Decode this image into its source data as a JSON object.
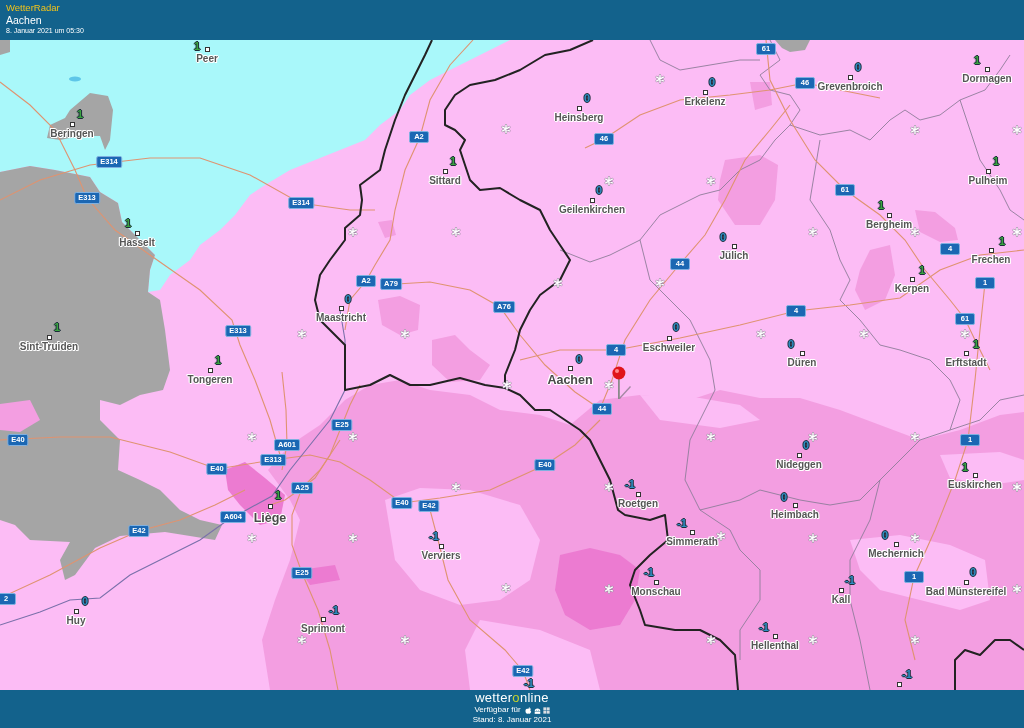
{
  "header": {
    "app_name": "WetterRadar",
    "location": "Aachen",
    "timestamp": "8. Januar 2021 um 05:30"
  },
  "map": {
    "places": [
      {
        "name": "Peer",
        "kind": "town",
        "temperature": "1",
        "color": "#3aa340"
      },
      {
        "name": "Grevenbroich",
        "kind": "town",
        "temperature": "0",
        "color": "#2f8dc2"
      },
      {
        "name": "Dormagen",
        "kind": "town",
        "temperature": "1",
        "color": "#3aa340"
      },
      {
        "name": "Erkelenz",
        "kind": "town",
        "temperature": "0",
        "color": "#2f8dc2"
      },
      {
        "name": "Heinsberg",
        "kind": "town",
        "temperature": "0",
        "color": "#2f8dc2"
      },
      {
        "name": "Beringen",
        "kind": "town",
        "temperature": "1",
        "color": "#3aa340"
      },
      {
        "name": "Sittard",
        "kind": "town",
        "temperature": "1",
        "color": "#3aa340"
      },
      {
        "name": "Pulheim",
        "kind": "town",
        "temperature": "1",
        "color": "#3aa340"
      },
      {
        "name": "Geilenkirchen",
        "kind": "town",
        "temperature": "0",
        "color": "#2f8dc2"
      },
      {
        "name": "Bergheim",
        "kind": "town",
        "temperature": "1",
        "color": "#3aa340"
      },
      {
        "name": "Hasselt",
        "kind": "town",
        "temperature": "1",
        "color": "#3aa340"
      },
      {
        "name": "Jülich",
        "kind": "town",
        "temperature": "0",
        "color": "#2f8dc2"
      },
      {
        "name": "Frechen",
        "kind": "town",
        "temperature": "1",
        "color": "#3aa340"
      },
      {
        "name": "Kerpen",
        "kind": "town",
        "temperature": "1",
        "color": "#3aa340"
      },
      {
        "name": "Maastricht",
        "kind": "town",
        "temperature": "0",
        "color": "#2f8dc2"
      },
      {
        "name": "Sint-Truiden",
        "kind": "town",
        "temperature": "1",
        "color": "#3aa340"
      },
      {
        "name": "Eschweiler",
        "kind": "town",
        "temperature": "0",
        "color": "#2f8dc2"
      },
      {
        "name": "Düren",
        "kind": "town",
        "temperature": "0",
        "color": "#2f8dc2"
      },
      {
        "name": "Erftstadt",
        "kind": "town",
        "temperature": "1",
        "color": "#3aa340"
      },
      {
        "name": "Tongeren",
        "kind": "town",
        "temperature": "1",
        "color": "#3aa340"
      },
      {
        "name": "Aachen",
        "kind": "city",
        "temperature": "0",
        "color": "#2f8dc2"
      },
      {
        "name": "Nideggen",
        "kind": "town",
        "temperature": "0",
        "color": "#2f8dc2"
      },
      {
        "name": "Euskirchen",
        "kind": "town",
        "temperature": "1",
        "color": "#3aa340"
      },
      {
        "name": "Liège",
        "kind": "city",
        "temperature": "1",
        "color": "#3aa340"
      },
      {
        "name": "Roetgen",
        "kind": "town",
        "temperature": "-1",
        "color": "#2f8dc2"
      },
      {
        "name": "Heimbach",
        "kind": "town",
        "temperature": "0",
        "color": "#2f8dc2"
      },
      {
        "name": "Verviers",
        "kind": "town",
        "temperature": "-1",
        "color": "#2f8dc2"
      },
      {
        "name": "Simmerath",
        "kind": "town",
        "temperature": "-1",
        "color": "#2f8dc2"
      },
      {
        "name": "Mechernich",
        "kind": "town",
        "temperature": "0",
        "color": "#2f8dc2"
      },
      {
        "name": "Monschau",
        "kind": "town",
        "temperature": "-1",
        "color": "#2f8dc2"
      },
      {
        "name": "Kall",
        "kind": "town",
        "temperature": "-1",
        "color": "#2f8dc2"
      },
      {
        "name": "Bad Münstereifel",
        "kind": "town",
        "temperature": "0",
        "color": "#2f8dc2"
      },
      {
        "name": "Huy",
        "kind": "town",
        "temperature": "0",
        "color": "#2f8dc2"
      },
      {
        "name": "Sprimont",
        "kind": "town",
        "temperature": "-1",
        "color": "#2f8dc2"
      },
      {
        "name": "Hellenthal",
        "kind": "town",
        "temperature": "-1",
        "color": "#2f8dc2"
      },
      {
        "temperature": "-1",
        "color": "#2f8dc2"
      },
      {
        "temperature": "-1",
        "color": "#2f8dc2"
      }
    ],
    "road_signs": [
      "61",
      "46",
      "A2",
      "46",
      "E314",
      "61",
      "E313",
      "E314",
      "4",
      "44",
      "A2",
      "A79",
      "1",
      "A76",
      "4",
      "61",
      "E313",
      "4",
      "44",
      "E25",
      "E40",
      "A601",
      "1",
      "E313",
      "E40",
      "E40",
      "A25",
      "E40",
      "E42",
      "A604",
      "E42",
      "E25",
      "1",
      "2",
      "E42"
    ]
  },
  "footer": {
    "logo": [
      {
        "text": "wetter",
        "accent": false
      },
      {
        "text": "o",
        "accent": true
      },
      {
        "text": "nline",
        "accent": false
      }
    ],
    "availability": "Verfügbar für",
    "stand": "Stand: 8. Januar 2021"
  }
}
